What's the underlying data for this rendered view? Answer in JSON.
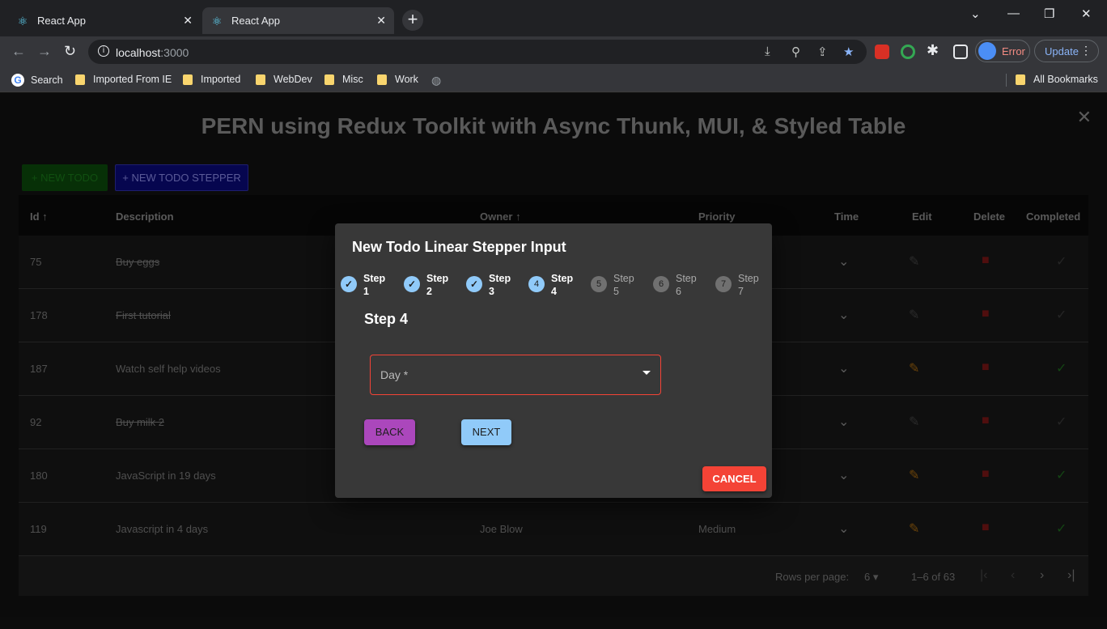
{
  "browser": {
    "tabs": [
      {
        "title": "React App",
        "active": false
      },
      {
        "title": "React App",
        "active": true
      }
    ],
    "url_host": "localhost",
    "url_port": ":3000",
    "error_label": "Error",
    "update_label": "Update",
    "bookmarks": [
      "Search",
      "Imported From IE",
      "Imported",
      "WebDev",
      "Misc",
      "Work"
    ],
    "all_bookmarks_label": "All Bookmarks"
  },
  "page": {
    "title": "PERN using Redux Toolkit with Async Thunk, MUI, & Styled Table",
    "new_todo_label": "+ NEW TODO",
    "new_todo_stepper_label": "+ NEW TODO STEPPER"
  },
  "table": {
    "headers": {
      "id": "Id ↑",
      "description": "Description",
      "owner": "Owner ↑",
      "priority": "Priority",
      "time": "Time",
      "edit": "Edit",
      "delete": "Delete",
      "completed": "Completed"
    },
    "rows": [
      {
        "id": "75",
        "description": "Buy eggs",
        "owner": "",
        "priority": "",
        "completed": true
      },
      {
        "id": "178",
        "description": "First tutorial",
        "owner": "",
        "priority": "",
        "completed": true
      },
      {
        "id": "187",
        "description": "Watch self help videos",
        "owner": "",
        "priority": "",
        "completed": false
      },
      {
        "id": "92",
        "description": "Buy milk 2",
        "owner": "",
        "priority": "",
        "completed": true
      },
      {
        "id": "180",
        "description": "JavaScript in 19 days",
        "owner": "",
        "priority": "",
        "completed": false
      },
      {
        "id": "119",
        "description": "Javascript in 4 days",
        "owner": "Joe Blow",
        "priority": "Medium",
        "completed": false
      }
    ],
    "footer": {
      "rows_per_page_label": "Rows per page:",
      "rows_per_page_value": "6",
      "range": "1–6 of 63"
    }
  },
  "dialog": {
    "title": "New Todo Linear Stepper Input",
    "steps": [
      {
        "num": "1",
        "line1": "Step",
        "line2": "1",
        "state": "done"
      },
      {
        "num": "2",
        "line1": "Step",
        "line2": "2",
        "state": "done"
      },
      {
        "num": "3",
        "line1": "Step",
        "line2": "3",
        "state": "done"
      },
      {
        "num": "4",
        "line1": "Step",
        "line2": "4",
        "state": "active"
      },
      {
        "num": "5",
        "line1": "Step",
        "line2": "5",
        "state": "todo"
      },
      {
        "num": "6",
        "line1": "Step",
        "line2": "6",
        "state": "todo"
      },
      {
        "num": "7",
        "line1": "Step",
        "line2": "7",
        "state": "todo"
      }
    ],
    "step_heading": "Step 4",
    "select_label": "Day *",
    "back_label": "BACK",
    "next_label": "NEXT",
    "cancel_label": "CANCEL"
  }
}
